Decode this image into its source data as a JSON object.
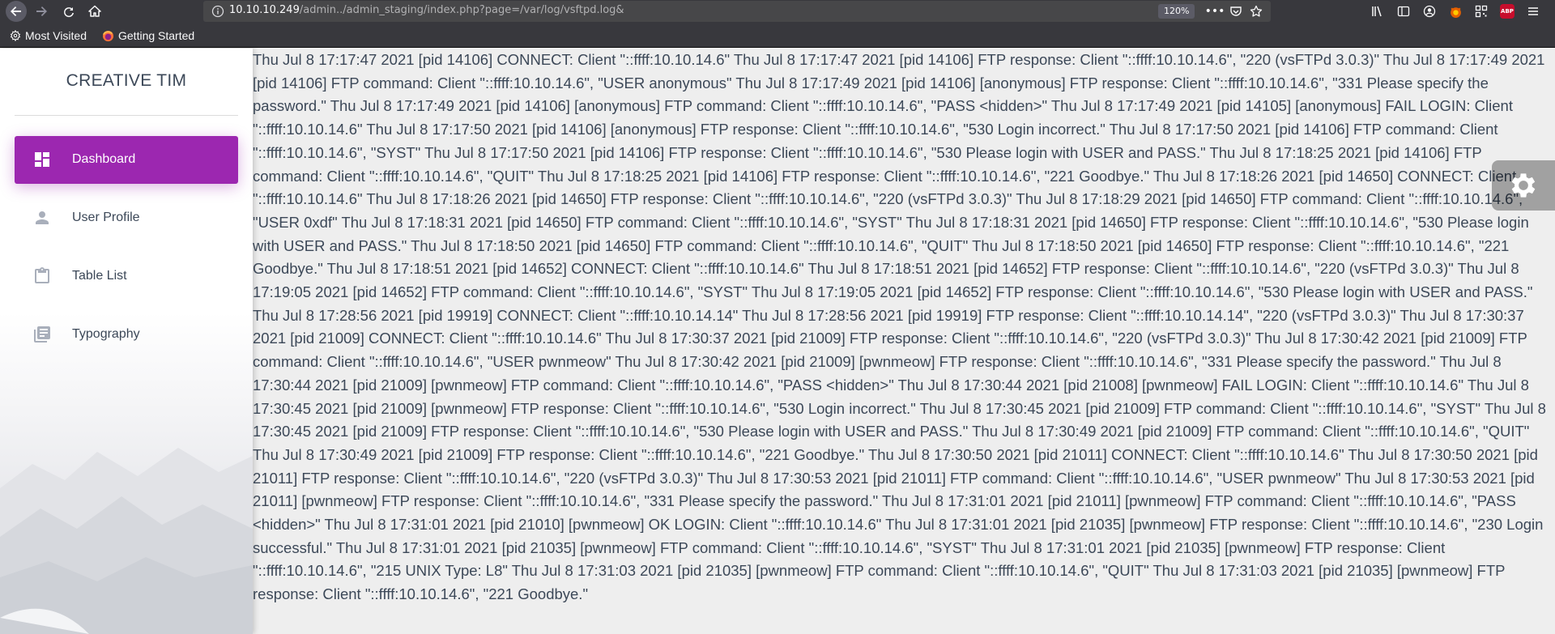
{
  "browser": {
    "url_prefix": "10.10.10.249",
    "url_rest": "/admin../admin_staging/index.php?page=/var/log/vsftpd.log&",
    "zoom": "120%",
    "bookmarks": [
      {
        "label": "Most Visited",
        "icon": "gear-icon"
      },
      {
        "label": "Getting Started",
        "icon": "firefox-icon"
      }
    ],
    "toolbar_icons": [
      "library-icon",
      "sidebar-icon",
      "account-icon",
      "extension-icon",
      "qr-icon",
      "adblock-icon",
      "menu-icon"
    ],
    "abp_label": "ABP"
  },
  "sidebar": {
    "brand": "CREATIVE TIM",
    "items": [
      {
        "label": "Dashboard",
        "icon": "dashboard-icon",
        "active": true
      },
      {
        "label": "User Profile",
        "icon": "person-icon",
        "active": false
      },
      {
        "label": "Table List",
        "icon": "clipboard-icon",
        "active": false
      },
      {
        "label": "Typography",
        "icon": "library-books-icon",
        "active": false
      }
    ],
    "active_color": "#9c27b0"
  },
  "log_text": "Thu Jul 8 17:17:47 2021 [pid 14106] CONNECT: Client \"::ffff:10.10.14.6\" Thu Jul 8 17:17:47 2021 [pid 14106] FTP response: Client \"::ffff:10.10.14.6\", \"220 (vsFTPd 3.0.3)\" Thu Jul 8 17:17:49 2021 [pid 14106] FTP command: Client \"::ffff:10.10.14.6\", \"USER anonymous\" Thu Jul 8 17:17:49 2021 [pid 14106] [anonymous] FTP response: Client \"::ffff:10.10.14.6\", \"331 Please specify the password.\" Thu Jul 8 17:17:49 2021 [pid 14106] [anonymous] FTP command: Client \"::ffff:10.10.14.6\", \"PASS <hidden>\" Thu Jul 8 17:17:49 2021 [pid 14105] [anonymous] FAIL LOGIN: Client \"::ffff:10.10.14.6\" Thu Jul 8 17:17:50 2021 [pid 14106] [anonymous] FTP response: Client \"::ffff:10.10.14.6\", \"530 Login incorrect.\" Thu Jul 8 17:17:50 2021 [pid 14106] FTP command: Client \"::ffff:10.10.14.6\", \"SYST\" Thu Jul 8 17:17:50 2021 [pid 14106] FTP response: Client \"::ffff:10.10.14.6\", \"530 Please login with USER and PASS.\" Thu Jul 8 17:18:25 2021 [pid 14106] FTP command: Client \"::ffff:10.10.14.6\", \"QUIT\" Thu Jul 8 17:18:25 2021 [pid 14106] FTP response: Client \"::ffff:10.10.14.6\", \"221 Goodbye.\" Thu Jul 8 17:18:26 2021 [pid 14650] CONNECT: Client \"::ffff:10.10.14.6\" Thu Jul 8 17:18:26 2021 [pid 14650] FTP response: Client \"::ffff:10.10.14.6\", \"220 (vsFTPd 3.0.3)\" Thu Jul 8 17:18:29 2021 [pid 14650] FTP command: Client \"::ffff:10.10.14.6\", \"USER 0xdf\" Thu Jul 8 17:18:31 2021 [pid 14650] FTP command: Client \"::ffff:10.10.14.6\", \"SYST\" Thu Jul 8 17:18:31 2021 [pid 14650] FTP response: Client \"::ffff:10.10.14.6\", \"530 Please login with USER and PASS.\" Thu Jul 8 17:18:50 2021 [pid 14650] FTP command: Client \"::ffff:10.10.14.6\", \"QUIT\" Thu Jul 8 17:18:50 2021 [pid 14650] FTP response: Client \"::ffff:10.10.14.6\", \"221 Goodbye.\" Thu Jul 8 17:18:51 2021 [pid 14652] CONNECT: Client \"::ffff:10.10.14.6\" Thu Jul 8 17:18:51 2021 [pid 14652] FTP response: Client \"::ffff:10.10.14.6\", \"220 (vsFTPd 3.0.3)\" Thu Jul 8 17:19:05 2021 [pid 14652] FTP command: Client \"::ffff:10.10.14.6\", \"SYST\" Thu Jul 8 17:19:05 2021 [pid 14652] FTP response: Client \"::ffff:10.10.14.6\", \"530 Please login with USER and PASS.\" Thu Jul 8 17:28:56 2021 [pid 19919] CONNECT: Client \"::ffff:10.10.14.14\" Thu Jul 8 17:28:56 2021 [pid 19919] FTP response: Client \"::ffff:10.10.14.14\", \"220 (vsFTPd 3.0.3)\" Thu Jul 8 17:30:37 2021 [pid 21009] CONNECT: Client \"::ffff:10.10.14.6\" Thu Jul 8 17:30:37 2021 [pid 21009] FTP response: Client \"::ffff:10.10.14.6\", \"220 (vsFTPd 3.0.3)\" Thu Jul 8 17:30:42 2021 [pid 21009] FTP command: Client \"::ffff:10.10.14.6\", \"USER pwnmeow\" Thu Jul 8 17:30:42 2021 [pid 21009] [pwnmeow] FTP response: Client \"::ffff:10.10.14.6\", \"331 Please specify the password.\" Thu Jul 8 17:30:44 2021 [pid 21009] [pwnmeow] FTP command: Client \"::ffff:10.10.14.6\", \"PASS <hidden>\" Thu Jul 8 17:30:44 2021 [pid 21008] [pwnmeow] FAIL LOGIN: Client \"::ffff:10.10.14.6\" Thu Jul 8 17:30:45 2021 [pid 21009] [pwnmeow] FTP response: Client \"::ffff:10.10.14.6\", \"530 Login incorrect.\" Thu Jul 8 17:30:45 2021 [pid 21009] FTP command: Client \"::ffff:10.10.14.6\", \"SYST\" Thu Jul 8 17:30:45 2021 [pid 21009] FTP response: Client \"::ffff:10.10.14.6\", \"530 Please login with USER and PASS.\" Thu Jul 8 17:30:49 2021 [pid 21009] FTP command: Client \"::ffff:10.10.14.6\", \"QUIT\" Thu Jul 8 17:30:49 2021 [pid 21009] FTP response: Client \"::ffff:10.10.14.6\", \"221 Goodbye.\" Thu Jul 8 17:30:50 2021 [pid 21011] CONNECT: Client \"::ffff:10.10.14.6\" Thu Jul 8 17:30:50 2021 [pid 21011] FTP response: Client \"::ffff:10.10.14.6\", \"220 (vsFTPd 3.0.3)\" Thu Jul 8 17:30:53 2021 [pid 21011] FTP command: Client \"::ffff:10.10.14.6\", \"USER pwnmeow\" Thu Jul 8 17:30:53 2021 [pid 21011] [pwnmeow] FTP response: Client \"::ffff:10.10.14.6\", \"331 Please specify the password.\" Thu Jul 8 17:31:01 2021 [pid 21011] [pwnmeow] FTP command: Client \"::ffff:10.10.14.6\", \"PASS <hidden>\" Thu Jul 8 17:31:01 2021 [pid 21010] [pwnmeow] OK LOGIN: Client \"::ffff:10.10.14.6\" Thu Jul 8 17:31:01 2021 [pid 21035] [pwnmeow] FTP response: Client \"::ffff:10.10.14.6\", \"230 Login successful.\" Thu Jul 8 17:31:01 2021 [pid 21035] [pwnmeow] FTP command: Client \"::ffff:10.10.14.6\", \"SYST\" Thu Jul 8 17:31:01 2021 [pid 21035] [pwnmeow] FTP response: Client \"::ffff:10.10.14.6\", \"215 UNIX Type: L8\" Thu Jul 8 17:31:03 2021 [pid 21035] [pwnmeow] FTP command: Client \"::ffff:10.10.14.6\", \"QUIT\" Thu Jul 8 17:31:03 2021 [pid 21035] [pwnmeow] FTP response: Client \"::ffff:10.10.14.6\", \"221 Goodbye.\"",
  "fixed_plugin": {
    "icon": "settings-gear-icon"
  }
}
